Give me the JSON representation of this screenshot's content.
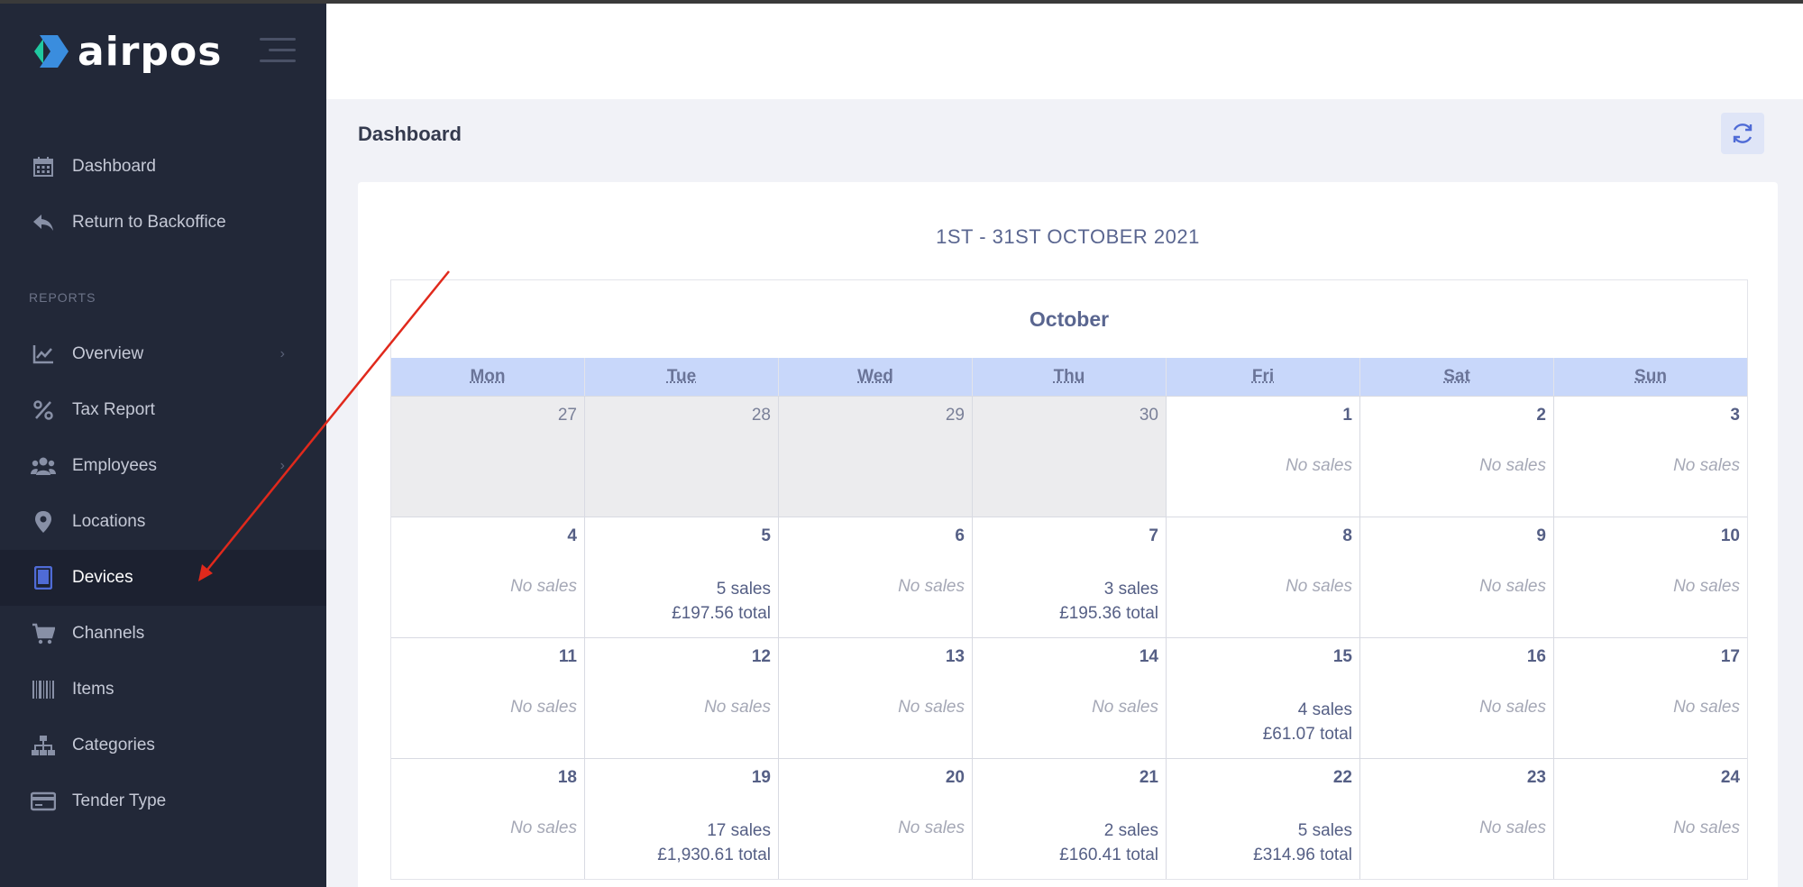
{
  "app": {
    "brand": "airpos"
  },
  "sidebar": {
    "items_top": [
      {
        "label": "Dashboard",
        "icon": "calendar-icon"
      },
      {
        "label": "Return to Backoffice",
        "icon": "reply-icon"
      }
    ],
    "section_label": "REPORTS",
    "items_reports": [
      {
        "label": "Overview",
        "icon": "chart-line-icon",
        "has_submenu": true
      },
      {
        "label": "Tax Report",
        "icon": "percent-icon"
      },
      {
        "label": "Employees",
        "icon": "users-icon",
        "has_submenu": true
      },
      {
        "label": "Locations",
        "icon": "map-pin-icon"
      },
      {
        "label": "Devices",
        "icon": "tablet-icon",
        "active": true
      },
      {
        "label": "Channels",
        "icon": "cart-icon"
      },
      {
        "label": "Items",
        "icon": "barcode-icon"
      },
      {
        "label": "Categories",
        "icon": "sitemap-icon"
      },
      {
        "label": "Tender Type",
        "icon": "credit-card-icon"
      }
    ],
    "chevron": "›"
  },
  "header": {
    "page_title": "Dashboard"
  },
  "card": {
    "title": "1ST - 31ST OCTOBER 2021"
  },
  "calendar": {
    "month": "October",
    "weekdays": [
      "Mon",
      "Tue",
      "Wed",
      "Thu",
      "Fri",
      "Sat",
      "Sun"
    ],
    "weeks": [
      [
        {
          "day": "27",
          "other": true
        },
        {
          "day": "28",
          "other": true
        },
        {
          "day": "29",
          "other": true
        },
        {
          "day": "30",
          "other": true
        },
        {
          "day": "1",
          "status": "No sales"
        },
        {
          "day": "2",
          "status": "No sales"
        },
        {
          "day": "3",
          "status": "No sales"
        }
      ],
      [
        {
          "day": "4",
          "status": "No sales"
        },
        {
          "day": "5",
          "sales": "5 sales",
          "total": "£197.56 total"
        },
        {
          "day": "6",
          "status": "No sales"
        },
        {
          "day": "7",
          "sales": "3 sales",
          "total": "£195.36 total"
        },
        {
          "day": "8",
          "status": "No sales"
        },
        {
          "day": "9",
          "status": "No sales"
        },
        {
          "day": "10",
          "status": "No sales"
        }
      ],
      [
        {
          "day": "11",
          "status": "No sales"
        },
        {
          "day": "12",
          "status": "No sales"
        },
        {
          "day": "13",
          "status": "No sales"
        },
        {
          "day": "14",
          "status": "No sales"
        },
        {
          "day": "15",
          "sales": "4 sales",
          "total": "£61.07 total"
        },
        {
          "day": "16",
          "status": "No sales"
        },
        {
          "day": "17",
          "status": "No sales"
        }
      ],
      [
        {
          "day": "18",
          "status": "No sales"
        },
        {
          "day": "19",
          "sales": "17 sales",
          "total": "£1,930.61 total"
        },
        {
          "day": "20",
          "status": "No sales"
        },
        {
          "day": "21",
          "sales": "2 sales",
          "total": "£160.41 total"
        },
        {
          "day": "22",
          "sales": "5 sales",
          "total": "£314.96 total"
        },
        {
          "day": "23",
          "status": "No sales"
        },
        {
          "day": "24",
          "status": "No sales"
        }
      ]
    ]
  },
  "colors": {
    "sidebar_bg": "#222838",
    "accent": "#4f6bd6",
    "annotation_arrow": "#e0291c"
  }
}
